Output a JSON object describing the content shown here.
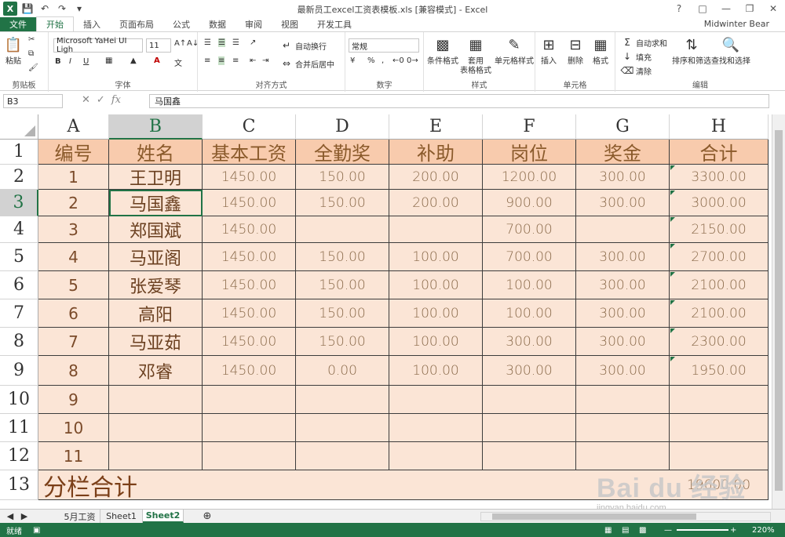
{
  "window": {
    "title": "最新员工excel工资表模板.xls  [兼容模式] - Excel",
    "account": "Midwinter Bear",
    "quick_access": [
      "excel-logo-icon",
      "save-icon",
      "undo-icon",
      "redo-icon",
      "customize-icon"
    ]
  },
  "ribbon": {
    "tabs": [
      "文件",
      "开始",
      "插入",
      "页面布局",
      "公式",
      "数据",
      "审阅",
      "视图",
      "开发工具"
    ],
    "active_tab": "开始",
    "clipboard": {
      "paste": "粘贴",
      "group": "剪贴板"
    },
    "font": {
      "name": "Microsoft YaHei UI Ligh",
      "size": "11",
      "group": "字体",
      "bold": "B",
      "italic": "I",
      "underline": "U"
    },
    "alignment": {
      "wrap": "自动换行",
      "merge": "合并后居中",
      "group": "对齐方式"
    },
    "number": {
      "format": "常规",
      "percent": "%",
      "group": "数字"
    },
    "styles": {
      "conditional": "条件格式",
      "table_line1": "套用",
      "table_line2": "表格格式",
      "cell_styles": "单元格样式",
      "group": "样式"
    },
    "cells": {
      "insert": "插入",
      "delete": "删除",
      "format": "格式",
      "group": "单元格"
    },
    "editing": {
      "autosum": "自动求和",
      "fill": "填充",
      "clear": "清除",
      "sort": "排序和筛选",
      "find": "查找和选择",
      "group": "编辑"
    }
  },
  "formula_bar": {
    "name_box": "B3",
    "fx": "fx",
    "content": "马国鑫"
  },
  "columns": [
    "A",
    "B",
    "C",
    "D",
    "E",
    "F",
    "G",
    "H"
  ],
  "rows": [
    "1",
    "2",
    "3",
    "4",
    "5",
    "6",
    "7",
    "8",
    "9",
    "10",
    "11",
    "12",
    "13"
  ],
  "selected_cell": {
    "col": "B",
    "row": "3"
  },
  "table": {
    "headers": [
      "编号",
      "姓名",
      "基本工资",
      "全勤奖",
      "补助",
      "岗位",
      "奖金",
      "合计"
    ],
    "data": [
      [
        "1",
        "王卫明",
        "1450.00",
        "150.00",
        "200.00",
        "1200.00",
        "300.00",
        "3300.00"
      ],
      [
        "2",
        "马国鑫",
        "1450.00",
        "150.00",
        "200.00",
        "900.00",
        "300.00",
        "3000.00"
      ],
      [
        "3",
        "郑国斌",
        "1450.00",
        "",
        "",
        "700.00",
        "",
        "2150.00"
      ],
      [
        "4",
        "马亚阁",
        "1450.00",
        "150.00",
        "100.00",
        "700.00",
        "300.00",
        "2700.00"
      ],
      [
        "5",
        "张爱琴",
        "1450.00",
        "150.00",
        "100.00",
        "100.00",
        "300.00",
        "2100.00"
      ],
      [
        "6",
        "高阳",
        "1450.00",
        "150.00",
        "100.00",
        "100.00",
        "300.00",
        "2100.00"
      ],
      [
        "7",
        "马亚茹",
        "1450.00",
        "150.00",
        "100.00",
        "300.00",
        "300.00",
        "2300.00"
      ],
      [
        "8",
        "邓睿",
        "1450.00",
        "0.00",
        "100.00",
        "300.00",
        "300.00",
        "1950.00"
      ],
      [
        "9",
        "",
        "",
        "",
        "",
        "",
        "",
        ""
      ],
      [
        "10",
        "",
        "",
        "",
        "",
        "",
        "",
        ""
      ],
      [
        "11",
        "",
        "",
        "",
        "",
        "",
        "",
        ""
      ]
    ],
    "total_label": "分栏合计",
    "total_value": "19600.00"
  },
  "sheets": [
    "5月工资",
    "Sheet1",
    "Sheet2"
  ],
  "active_sheet": "Sheet2",
  "status": {
    "ready": "就绪",
    "zoom": "220%"
  },
  "watermark": {
    "logo": "Bai du 经验",
    "url": "jingyan.baidu.com"
  },
  "colors": {
    "excel_green": "#217346",
    "header_fill": "#f8cbad",
    "body_fill": "#fbe5d6"
  }
}
